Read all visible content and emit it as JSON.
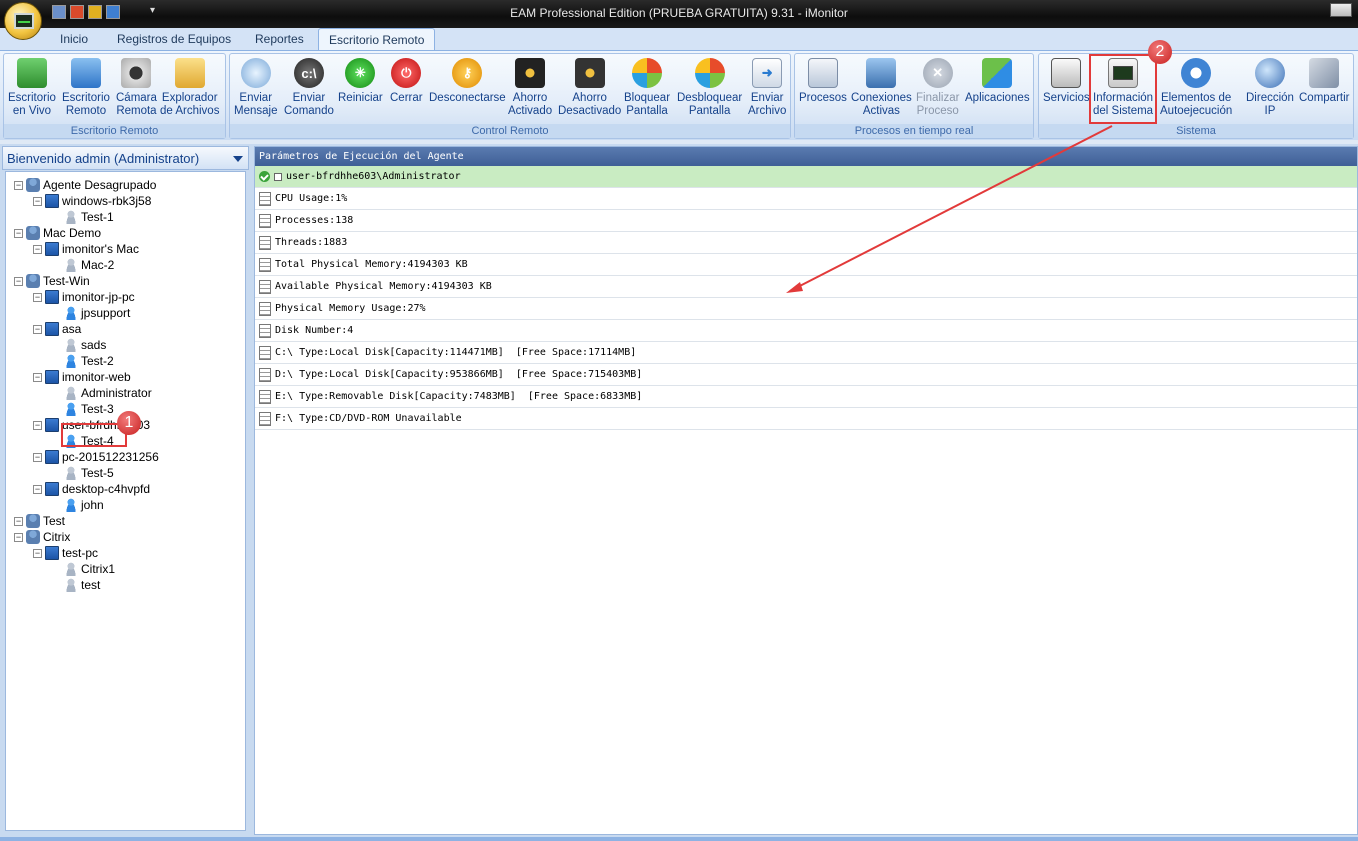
{
  "window": {
    "title": "EAM Professional Edition (PRUEBA GRATUITA) 9.31 - iMonitor"
  },
  "tabs": [
    {
      "label": "Inicio",
      "active": false
    },
    {
      "label": "Registros de Equipos",
      "active": false
    },
    {
      "label": "Reportes",
      "active": false
    },
    {
      "label": "Escritorio Remoto",
      "active": true
    }
  ],
  "ribbon": {
    "groups": [
      {
        "title": "Escritorio Remoto",
        "buttons": [
          {
            "label": "Escritorio\nen Vivo",
            "icon": "live-desktop-icon"
          },
          {
            "label": "Escritorio\nRemoto",
            "icon": "remote-desktop-icon"
          },
          {
            "label": "Cámara\nRemota",
            "icon": "webcam-icon"
          },
          {
            "label": "Explorador\nde Archivos",
            "icon": "folder-search-icon"
          }
        ]
      },
      {
        "title": "Control Remoto",
        "buttons": [
          {
            "label": "Enviar\nMensaje",
            "icon": "message-icon"
          },
          {
            "label": "Enviar\nComando",
            "icon": "command-icon"
          },
          {
            "label": "Reiniciar",
            "icon": "restart-icon"
          },
          {
            "label": "Cerrar",
            "icon": "power-icon"
          },
          {
            "label": "Desconectarse",
            "icon": "key-icon"
          },
          {
            "label": "Ahorro\nActivado",
            "icon": "screensaver-on-icon"
          },
          {
            "label": "Ahorro\nDesactivado",
            "icon": "screensaver-off-icon"
          },
          {
            "label": "Bloquear\nPantalla",
            "icon": "lock-screen-icon"
          },
          {
            "label": "Desbloquear\nPantalla",
            "icon": "unlock-screen-icon"
          },
          {
            "label": "Enviar\nArchivo",
            "icon": "send-file-icon"
          }
        ]
      },
      {
        "title": "Procesos en tiempo real",
        "buttons": [
          {
            "label": "Procesos",
            "icon": "processes-icon"
          },
          {
            "label": "Conexiones\nActivas",
            "icon": "connections-icon"
          },
          {
            "label": "Finalizar\nProceso",
            "icon": "end-process-icon",
            "disabled": true
          },
          {
            "label": "Aplicaciones",
            "icon": "applications-icon"
          }
        ]
      },
      {
        "title": "Sistema",
        "buttons": [
          {
            "label": "Servicios",
            "icon": "services-icon"
          },
          {
            "label": "Información\ndel Sistema",
            "icon": "system-info-icon"
          },
          {
            "label": "Elementos de\nAutoejecución",
            "icon": "gear-icon"
          },
          {
            "label": "Dirección\nIP",
            "icon": "ip-globe-icon"
          },
          {
            "label": "Compartir",
            "icon": "share-icon"
          }
        ]
      }
    ]
  },
  "sidebar": {
    "header": "Bienvenido admin (Administrator)",
    "tree": [
      {
        "label": "Agente Desagrupado",
        "type": "group",
        "level": 0
      },
      {
        "label": "windows-rbk3j58",
        "type": "pc",
        "level": 1
      },
      {
        "label": "Test-1",
        "type": "user",
        "level": 2
      },
      {
        "label": "Mac Demo",
        "type": "group",
        "level": 0
      },
      {
        "label": "imonitor's Mac",
        "type": "pc",
        "level": 1
      },
      {
        "label": "Mac-2",
        "type": "user",
        "level": 2
      },
      {
        "label": "Test-Win",
        "type": "group",
        "level": 0
      },
      {
        "label": "imonitor-jp-pc",
        "type": "pc",
        "level": 1
      },
      {
        "label": "jpsupport",
        "type": "user-on",
        "level": 2
      },
      {
        "label": "asa",
        "type": "pc",
        "level": 1
      },
      {
        "label": "sads",
        "type": "user",
        "level": 2
      },
      {
        "label": "Test-2",
        "type": "user-on",
        "level": 2
      },
      {
        "label": "imonitor-web",
        "type": "pc",
        "level": 1
      },
      {
        "label": "Administrator",
        "type": "user",
        "level": 2
      },
      {
        "label": "Test-3",
        "type": "user-on",
        "level": 2
      },
      {
        "label": "user-bfrdhhe603",
        "type": "pc",
        "level": 1
      },
      {
        "label": "Test-4",
        "type": "user-on",
        "level": 2
      },
      {
        "label": "pc-201512231256",
        "type": "pc",
        "level": 1
      },
      {
        "label": "Test-5",
        "type": "user",
        "level": 2
      },
      {
        "label": "desktop-c4hvpfd",
        "type": "pc",
        "level": 1
      },
      {
        "label": "john",
        "type": "user-on",
        "level": 2
      },
      {
        "label": "Test",
        "type": "group",
        "level": 0
      },
      {
        "label": "Citrix",
        "type": "group",
        "level": 0
      },
      {
        "label": "test-pc",
        "type": "pc",
        "level": 1
      },
      {
        "label": "Citrix1",
        "type": "user",
        "level": 2
      },
      {
        "label": "test",
        "type": "user",
        "level": 2
      }
    ]
  },
  "panel": {
    "header": "Parámetros de Ejecución del Agente",
    "agent": "user-bfrdhhe603\\Administrator",
    "rows": [
      "CPU Usage:1%",
      "Processes:138",
      "Threads:1883",
      "Total Physical Memory:4194303 KB",
      "Available Physical Memory:4194303 KB",
      "Physical Memory Usage:27%",
      "Disk Number:4",
      "C:\\ Type:Local Disk[Capacity:114471MB]  [Free Space:17114MB]",
      "D:\\ Type:Local Disk[Capacity:953866MB]  [Free Space:715403MB]",
      "E:\\ Type:Removable Disk[Capacity:7483MB]  [Free Space:6833MB]",
      "F:\\ Type:CD/DVD-ROM Unavailable"
    ]
  },
  "annotations": {
    "badge1": "1",
    "badge2": "2"
  },
  "colors": {
    "highlight": "#e23a3a",
    "agent_row": "#c9ecc2",
    "panel_header": "#4a6aa0"
  }
}
